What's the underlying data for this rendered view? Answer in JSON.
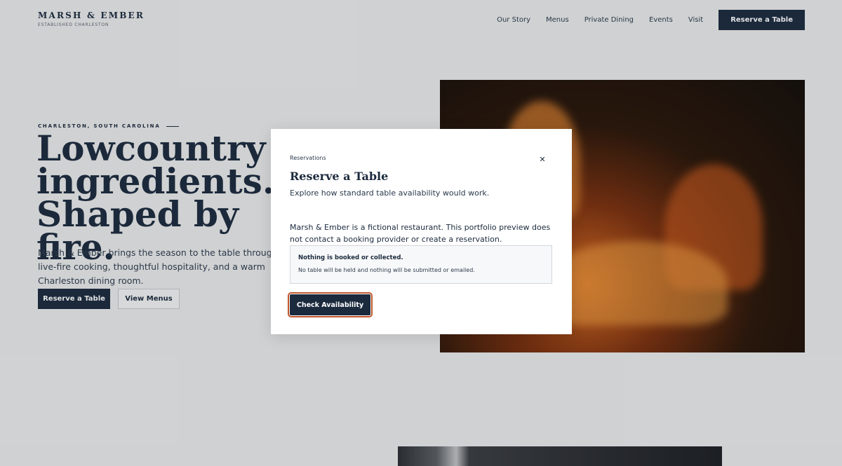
{
  "header": {
    "brand_name": "MARSH & EMBER",
    "brand_tagline": "ESTABLISHED CHARLESTON",
    "nav": [
      "Our Story",
      "Menus",
      "Private Dining",
      "Events",
      "Visit"
    ],
    "cta": "Reserve a Table"
  },
  "hero": {
    "eyebrow": "CHARLESTON, SOUTH CAROLINA",
    "title": "Lowcountry ingredients. Shaped by fire.",
    "body": "Marsh & Ember brings the season to the table through live-fire cooking, thoughtful hospitality, and a warm Charleston dining room.",
    "primary_button": "Reserve a Table",
    "secondary_button": "View Menus"
  },
  "modal": {
    "eyebrow": "Reservations",
    "close_icon": "close-icon",
    "title": "Reserve a Table",
    "subtitle": "Explore how standard table availability would work.",
    "disclaimer": "Marsh & Ember is a fictional restaurant. This portfolio preview does not contact a booking provider or create a reservation.",
    "notice_title": "Nothing is booked or collected.",
    "notice_body": "No table will be held and nothing will be submitted or emailed.",
    "button": "Check Availability"
  },
  "colors": {
    "navy": "#1b2a3d",
    "background": "#ebebeb",
    "focus_ring": "#c0562a"
  }
}
